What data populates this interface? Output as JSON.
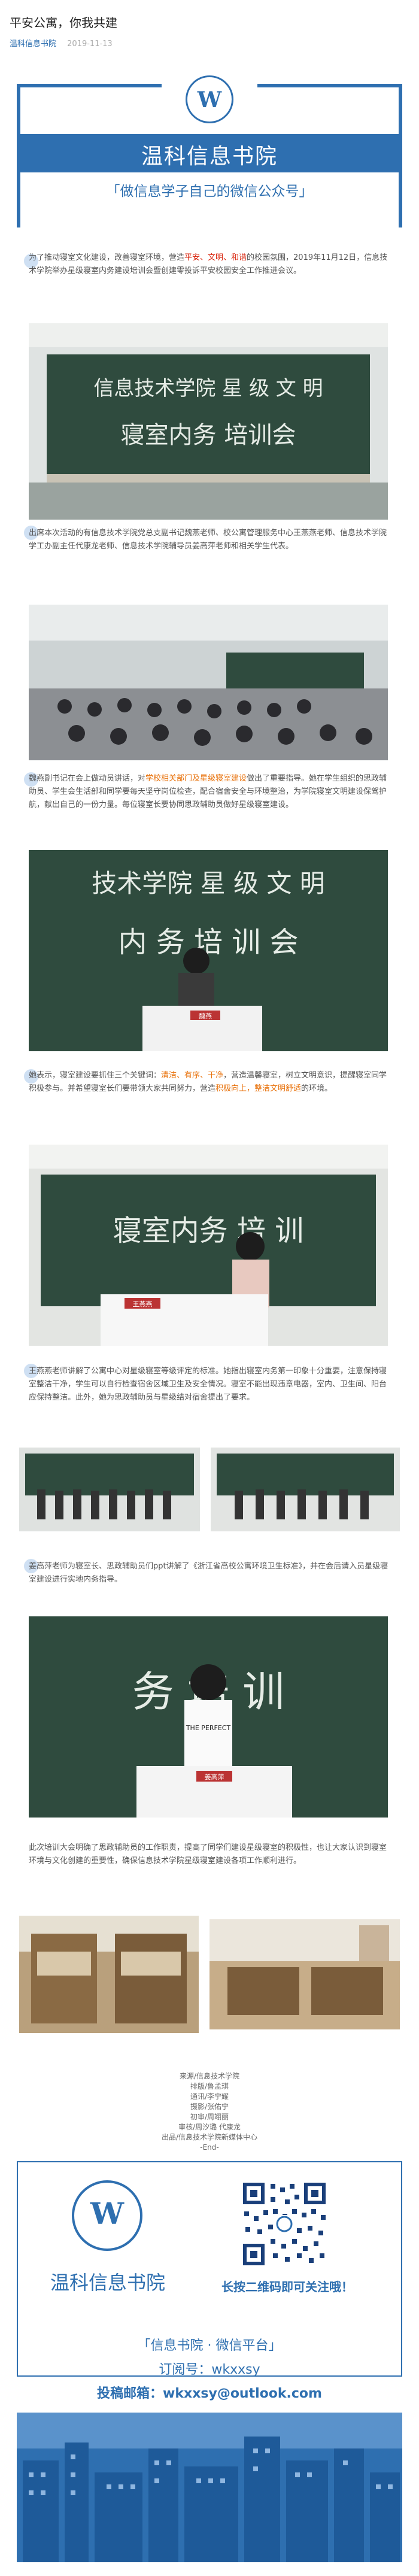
{
  "article": {
    "title": "平安公寓，你我共建",
    "source": "温科信息书院",
    "date": "2019-11-13"
  },
  "header": {
    "brand": "温科信息书院",
    "slogan": "「做信息学子自己的微信公众号」",
    "logo_letter": "W"
  },
  "paragraphs": {
    "p1_a": "为了推动寝室文化建设，改善寝室环境，营造",
    "p1_hl": "平安、文明、和谐",
    "p1_b": "的校园氛围，2019年11月12日，信息技术学院举办星级寝室内务建设培训会暨创建零投诉平安校园安全工作推进会议。",
    "p2": "出席本次活动的有信息技术学院党总支副书记魏燕老师、校公寓管理服务中心王燕燕老师、信息技术学院学工办副主任代康龙老师、信息技术学院辅导员姜高萍老师和相关学生代表。",
    "p3_a": "魏燕副书记在会上做动员讲话，对",
    "p3_hl": "学校相关部门及星级寝室建设",
    "p3_b": "做出了重要指导。她在学生组织的思政辅助员、学生会生活部和同学要每天坚守岗位检查，配合宿舍安全与环境整治，为学院寝室文明建设保驾护航，献出自己的一份力量。每位寝室长要协同思政辅助员做好星级寝室建设。",
    "p4_a": "她表示，寝室建设要抓住三个关键词：",
    "p4_hl1": "清洁、有序、干净",
    "p4_b": "，营造温馨寝室，树立文明意识，提醒寝室同学积极参与。并希望寝室长们要带领大家共同努力，营造",
    "p4_hl2": "积极向上，整洁文明舒适",
    "p4_c": "的环境。",
    "p5": "王燕燕老师讲解了公寓中心对星级寝室等级评定的标准。她指出寝室内务第一印象十分重要，注意保持寝室整洁干净，学生可以自行检查宿舍区域卫生及安全情况。寝室不能出现违章电器，室内、卫生间、阳台应保持整洁。此外，她为思政辅助员与星级结对宿舍提出了要求。",
    "p6": "姜高萍老师为寝室长、思政辅助员们ppt讲解了《浙江省高校公寓环境卫生标准》，并在会后请入员星级寝室建设进行实地内务指导。",
    "p7": "此次培训大会明确了思政辅助员的工作职责，提高了同学们建设星级寝室的积极性，也让大家认识到寝室环境与文化创建的重要性，确保信息技术学院星级寝室建设各项工作顺利进行。"
  },
  "credits": [
    "来源/信息技术学院",
    "排版/鲁孟琪",
    "通讯/李宁耀",
    "摄影/张佑宁",
    "初审/周翊丽",
    "审核/周汐璐 代康龙",
    "出品/信息技术学院新媒体中心",
    "-End-"
  ],
  "footer": {
    "brand": "温科信息书院",
    "qr_caption": "长按二维码即可关注哦！",
    "platform": "「信息书院 · 微信平台」",
    "subscribe": "订阅号：wkxxsy",
    "email": "投稿邮箱：wkxxsy@outlook.com"
  },
  "photos": {
    "p1_board": "信息技术学院 星 级 文 明",
    "p1_board2": "寝室内务 培训会",
    "p3_board": "技术学院 星 级 文 明",
    "p3_board2": "内 务 培 训 会",
    "p3_sign": "魏燕",
    "p4_board": "寝室内务 培 训",
    "p4_sign": "王燕燕",
    "p6_board": "务 培 训",
    "p6_sign": "姜高萍",
    "p6_shirt": "THE PERFECT"
  },
  "colors": {
    "brand_blue": "#2e6fb0",
    "board_green": "#2f4b3e",
    "highlight_orange": "#e8710a",
    "highlight_red": "#d81e06"
  }
}
